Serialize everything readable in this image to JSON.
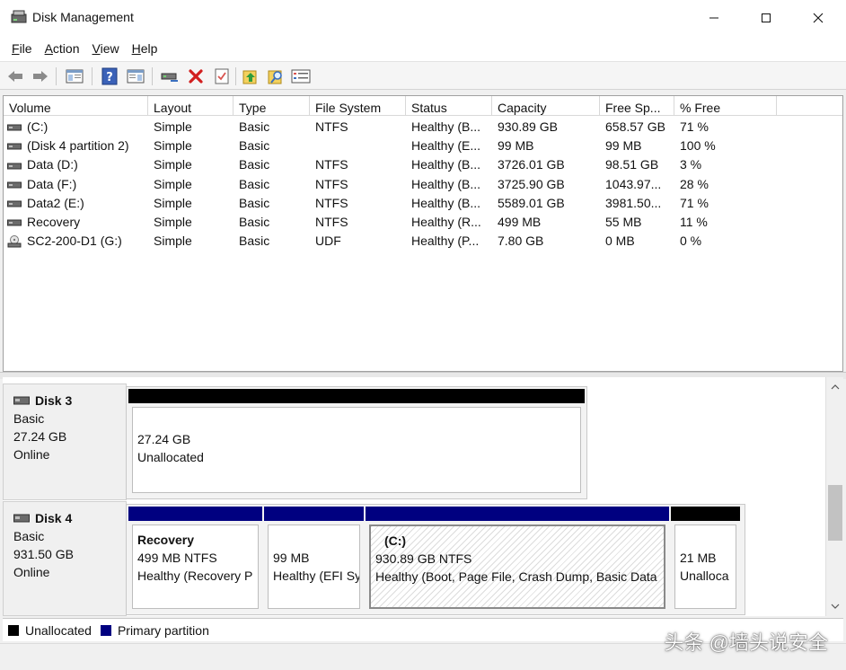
{
  "window": {
    "title": "Disk Management"
  },
  "menu": [
    {
      "accel": "F",
      "rest": "ile"
    },
    {
      "accel": "A",
      "rest": "ction"
    },
    {
      "accel": "V",
      "rest": "iew"
    },
    {
      "accel": "H",
      "rest": "elp"
    }
  ],
  "toolbar": {
    "icons": [
      "back-icon",
      "forward-icon",
      "show-hide-console-tree-icon",
      "help-icon",
      "show-hide-action-pane-icon",
      "connect-drive-icon",
      "delete-icon",
      "properties-icon",
      "up-folder-icon",
      "search-icon",
      "list-view-icon"
    ]
  },
  "volume_table": {
    "columns": [
      "Volume",
      "Layout",
      "Type",
      "File System",
      "Status",
      "Capacity",
      "Free Sp...",
      "% Free"
    ],
    "rows": [
      {
        "icon": "drive-icon",
        "volume": "(C:)",
        "layout": "Simple",
        "type": "Basic",
        "fs": "NTFS",
        "status": "Healthy (B...",
        "capacity": "930.89 GB",
        "free": "658.57 GB",
        "pct": "71 %"
      },
      {
        "icon": "drive-icon",
        "volume": "(Disk 4 partition 2)",
        "layout": "Simple",
        "type": "Basic",
        "fs": "",
        "status": "Healthy (E...",
        "capacity": "99 MB",
        "free": "99 MB",
        "pct": "100 %"
      },
      {
        "icon": "drive-icon",
        "volume": "Data (D:)",
        "layout": "Simple",
        "type": "Basic",
        "fs": "NTFS",
        "status": "Healthy (B...",
        "capacity": "3726.01 GB",
        "free": "98.51 GB",
        "pct": "3 %"
      },
      {
        "icon": "drive-icon",
        "volume": "Data (F:)",
        "layout": "Simple",
        "type": "Basic",
        "fs": "NTFS",
        "status": "Healthy (B...",
        "capacity": "3725.90 GB",
        "free": "1043.97...",
        "pct": "28 %"
      },
      {
        "icon": "drive-icon",
        "volume": "Data2 (E:)",
        "layout": "Simple",
        "type": "Basic",
        "fs": "NTFS",
        "status": "Healthy (B...",
        "capacity": "5589.01 GB",
        "free": "3981.50...",
        "pct": "71 %"
      },
      {
        "icon": "drive-icon",
        "volume": "Recovery",
        "layout": "Simple",
        "type": "Basic",
        "fs": "NTFS",
        "status": "Healthy (R...",
        "capacity": "499 MB",
        "free": "55 MB",
        "pct": "11 %"
      },
      {
        "icon": "cd-drive-icon",
        "volume": "SC2-200-D1 (G:)",
        "layout": "Simple",
        "type": "Basic",
        "fs": "UDF",
        "status": "Healthy (P...",
        "capacity": "7.80 GB",
        "free": "0 MB",
        "pct": "0 %"
      }
    ]
  },
  "disks": [
    {
      "name": "Disk 3",
      "type": "Basic",
      "size": "27.24 GB",
      "state": "Online",
      "partitions": [
        {
          "bar": "unallocated",
          "title": "",
          "line1": "27.24 GB",
          "line2": "Unallocated",
          "selected": false
        }
      ]
    },
    {
      "name": "Disk 4",
      "type": "Basic",
      "size": "931.50 GB",
      "state": "Online",
      "partitions": [
        {
          "bar": "primary",
          "title": "Recovery",
          "line1": "499 MB NTFS",
          "line2": "Healthy (Recovery P",
          "selected": false
        },
        {
          "bar": "primary",
          "title": "",
          "line1": "99 MB",
          "line2": "Healthy (EFI Sy",
          "selected": false
        },
        {
          "bar": "primary",
          "title": "(C:)",
          "line1": "930.89 GB NTFS",
          "line2": "Healthy (Boot, Page File, Crash Dump, Basic Data",
          "selected": true
        },
        {
          "bar": "unallocated",
          "title": "",
          "line1": "21 MB",
          "line2": "Unalloca",
          "selected": false
        }
      ]
    }
  ],
  "legend": [
    {
      "label": "Unallocated",
      "color": "#000000"
    },
    {
      "label": "Primary partition",
      "color": "#000080"
    }
  ],
  "colors": {
    "primary": "#000080",
    "unallocated": "#000000"
  },
  "watermark": "头条 @墙头说安全"
}
